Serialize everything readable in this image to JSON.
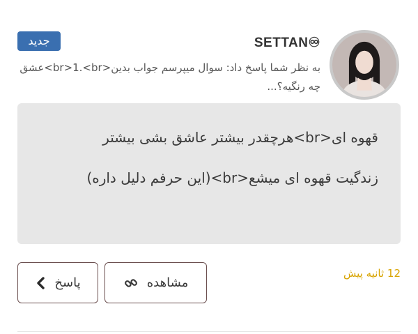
{
  "badge": {
    "label": "جدید"
  },
  "user": {
    "name": "SETTAN♾"
  },
  "notification": {
    "text": "به نظر شما پاسخ داد: سوال میپرسم جواب بدین<br>1.<br>عشق چه رنگیه؟..."
  },
  "reply": {
    "text": "قهوه ای<br>هرچقدر بیشتر عاشق بشی بیشتر زندگیت قهوه ای میشع<br>(این حرفم دلیل داره)"
  },
  "meta": {
    "time": "12 ثانیه پیش"
  },
  "actions": {
    "view_label": "مشاهده",
    "reply_label": "پاسخ"
  },
  "icons": {
    "view": "link-icon",
    "reply": "chevron-left-icon"
  },
  "colors": {
    "badge": "#3a6fb0",
    "time": "#d8a400",
    "bubble": "#e7e7e7",
    "button_border": "#6b4f4f"
  }
}
